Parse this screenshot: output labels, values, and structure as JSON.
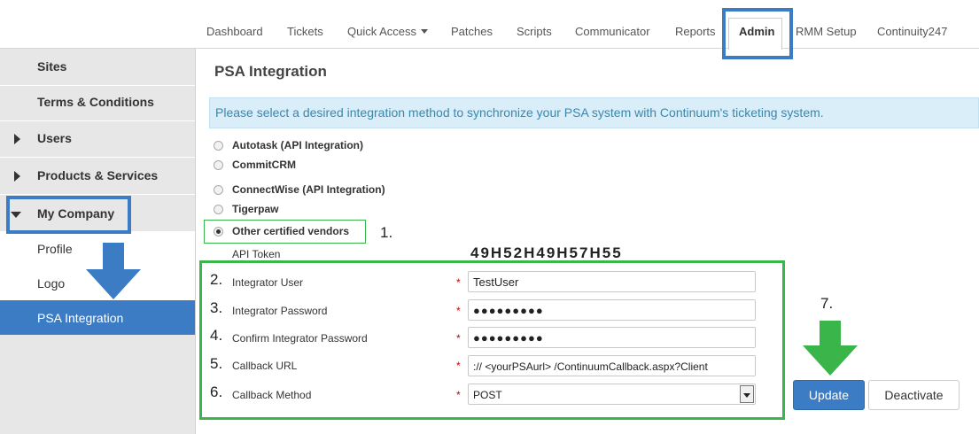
{
  "nav": {
    "tabs": [
      {
        "label": "Dashboard"
      },
      {
        "label": "Tickets"
      },
      {
        "label": "Quick Access"
      },
      {
        "label": "Patches"
      },
      {
        "label": "Scripts"
      },
      {
        "label": "Communicator"
      },
      {
        "label": "Reports"
      },
      {
        "label": "Admin"
      },
      {
        "label": "RMM Setup"
      },
      {
        "label": "Continuity247"
      }
    ],
    "active_tab": "Admin"
  },
  "sidebar": {
    "items": [
      {
        "label": "Sites"
      },
      {
        "label": "Terms & Conditions"
      },
      {
        "label": "Users"
      },
      {
        "label": "Products & Services"
      },
      {
        "label": "My Company"
      }
    ],
    "sub_items": [
      {
        "label": "Profile"
      },
      {
        "label": "Logo"
      },
      {
        "label": "PSA Integration"
      }
    ],
    "active_sub_item": "PSA Integration"
  },
  "main": {
    "title": "PSA Integration",
    "info_message": "Please select a desired integration method to synchronize your PSA system with Continuum's ticketing system.",
    "options": [
      {
        "label": "Autotask (API Integration)",
        "checked": false
      },
      {
        "label": "CommitCRM",
        "checked": false
      },
      {
        "label": "ConnectWise (API Integration)",
        "checked": false
      },
      {
        "label": "Tigerpaw",
        "checked": false
      },
      {
        "label": "Other certified vendors",
        "checked": true
      }
    ],
    "api_token_label": "API Token",
    "api_token_value": "49H52H49H57H55",
    "form": {
      "integrator_user": {
        "label": "Integrator User",
        "value": "TestUser"
      },
      "integrator_password": {
        "label": "Integrator Password",
        "value": "●●●●●●●●●"
      },
      "confirm_password": {
        "label": "Confirm Integrator Password",
        "value": "●●●●●●●●●"
      },
      "callback_url": {
        "label": "Callback URL",
        "value": "://   <yourPSAurl>  /ContinuumCallback.aspx?Client"
      },
      "callback_method": {
        "label": "Callback Method",
        "value": "POST"
      }
    },
    "required_mark": "*",
    "update_label": "Update",
    "deactivate_label": "Deactivate"
  },
  "annotations": {
    "step1": "1.",
    "step2": "2.",
    "step3": "3.",
    "step4": "4.",
    "step5": "5.",
    "step6": "6.",
    "step7": "7."
  },
  "colors": {
    "accent_blue": "#3b7cc4",
    "annotation_green": "#3ab54a",
    "info_bg": "#d9eef8",
    "info_text": "#3a87ad"
  }
}
